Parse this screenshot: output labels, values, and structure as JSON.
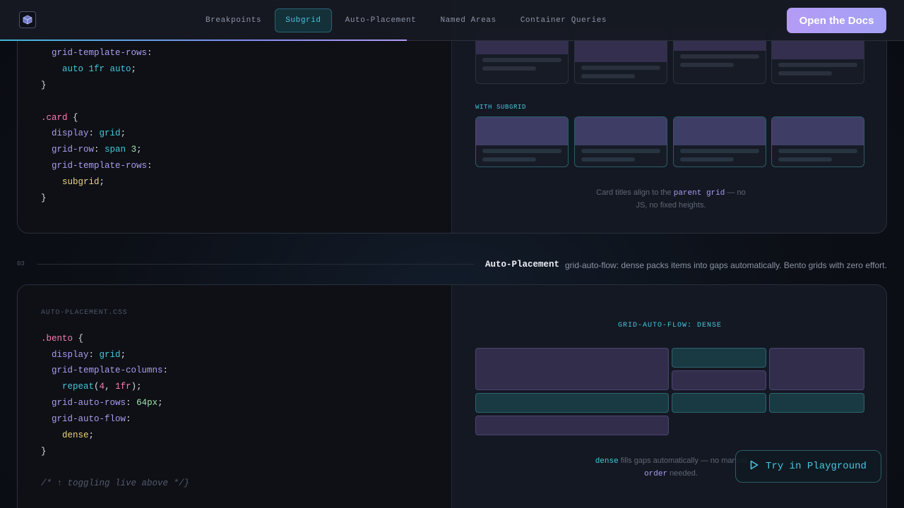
{
  "nav": {
    "logo_icon": "cube-icon",
    "items": [
      {
        "label": "Breakpoints",
        "active": false
      },
      {
        "label": "Subgrid",
        "active": true
      },
      {
        "label": "Auto-Placement",
        "active": false
      },
      {
        "label": "Named Areas",
        "active": false
      },
      {
        "label": "Container Queries",
        "active": false
      }
    ],
    "cta_label": "Open the Docs",
    "scroll_progress": 0.45
  },
  "subgrid_section": {
    "code": {
      "lines": [
        {
          "indent": 1,
          "prop": "grid-template-rows"
        },
        {
          "indent": 2,
          "value": "auto 1fr auto"
        },
        {
          "close": "}"
        },
        {
          "selector": ".card",
          "open": "{"
        },
        {
          "indent": 1,
          "prop": "display",
          "value": "grid"
        },
        {
          "indent": 1,
          "prop": "grid-row",
          "value": "span",
          "num": "3"
        },
        {
          "indent": 1,
          "prop": "grid-template-rows"
        },
        {
          "indent": 2,
          "keyword": "subgrid"
        },
        {
          "close": "}"
        }
      ]
    },
    "with_subgrid_label": "WITH SUBGRID",
    "caption_before": "Card titles align to the",
    "caption_highlight": "parent grid",
    "caption_after": "— no JS, no fixed heights."
  },
  "auto_section": {
    "number": "03",
    "title": "Auto-Placement",
    "description": "grid-auto-flow: dense packs items into gaps automatically. Bento grids with zero effort.",
    "file_label": "AUTO-PLACEMENT.CSS",
    "code": {
      "selector": ".bento",
      "display_prop": "display",
      "display_val": "grid",
      "cols_prop": "grid-template-columns",
      "repeat_fn": "repeat",
      "repeat_count": "4",
      "repeat_size": "1fr",
      "rows_prop": "grid-auto-rows",
      "rows_val": "64px",
      "flow_prop": "grid-auto-flow",
      "flow_val": "dense",
      "comment": "/* ↑ toggling live above */}"
    },
    "preview_label": "GRID-AUTO-FLOW: DENSE",
    "caption_kw1": "dense",
    "caption_mid": "fills gaps automatically — no manual",
    "caption_kw2": "order",
    "caption_end": "needed.",
    "try_button": "Try in Playground",
    "try_icon": "play-icon"
  },
  "colors": {
    "accent_cyan": "#45c6e0",
    "accent_violet": "#b49bf6",
    "selector_pink": "#ff7ab2",
    "property_violet": "#a99cf3",
    "keyword_yellow": "#f1d27a",
    "number_green": "#9fe3a9"
  }
}
